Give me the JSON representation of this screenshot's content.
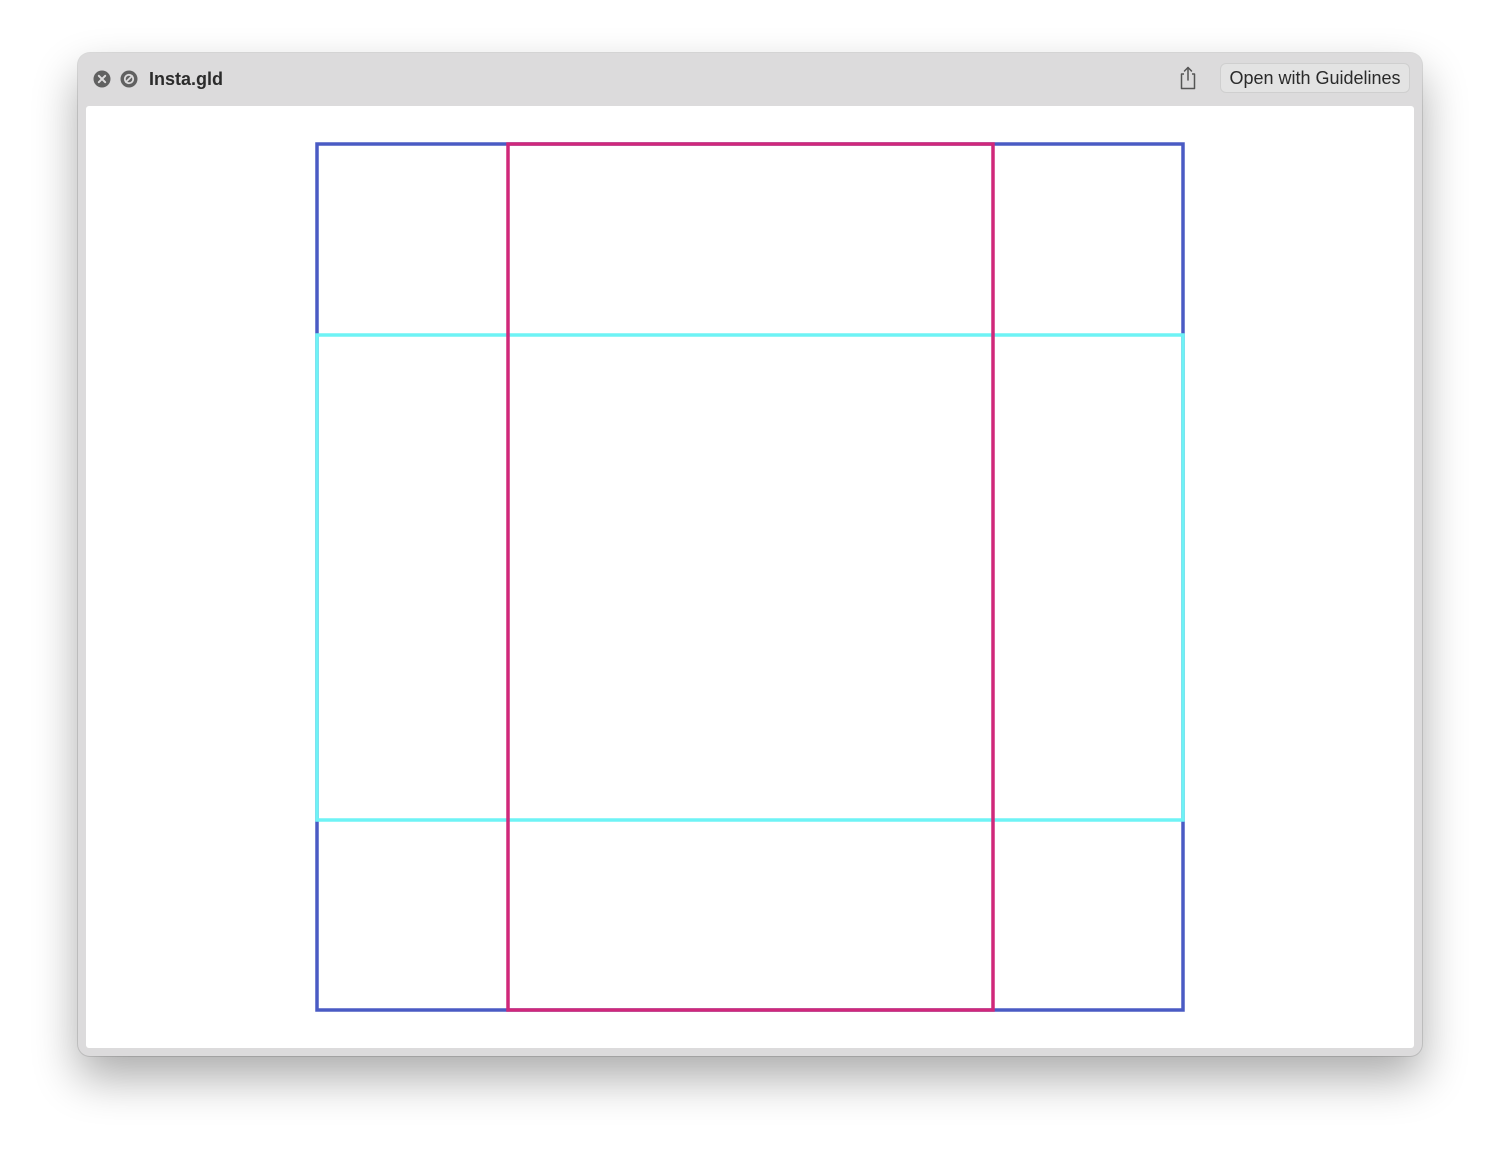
{
  "window": {
    "title": "Insta.gld",
    "open_button_label": "Open with Guidelines"
  },
  "icons": {
    "close": "close-icon",
    "block": "no-entry-icon",
    "share": "share-icon"
  },
  "guides": {
    "outer_color": "#4a5bc4",
    "vertical_color": "#d0287a",
    "horizontal_color": "#6ef3f5"
  }
}
